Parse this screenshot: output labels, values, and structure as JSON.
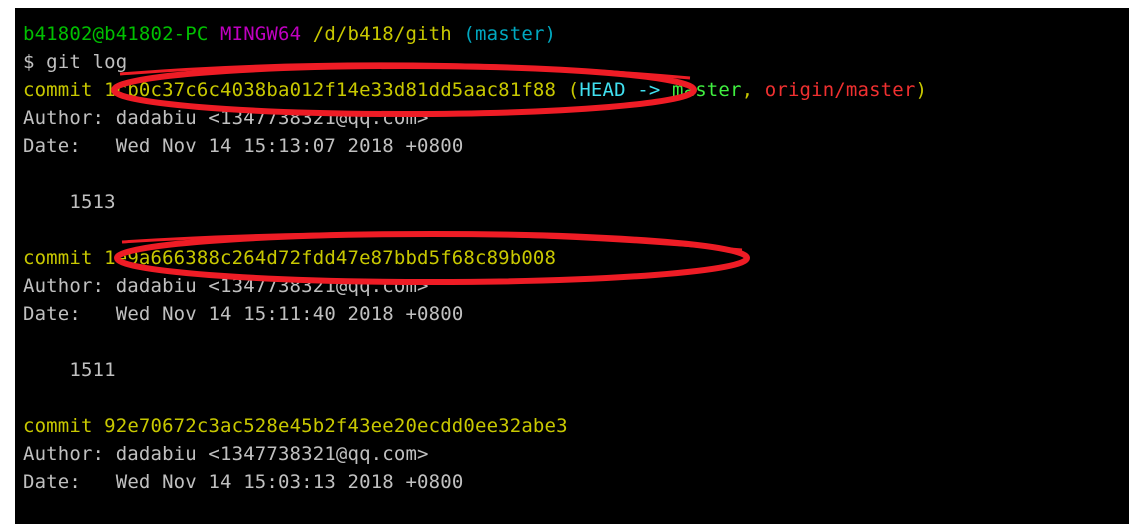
{
  "prompt": {
    "user_host": "b41802@b41802-PC",
    "system": "MINGW64",
    "path": "/d/b418/gith",
    "branch": "(master)",
    "command": "$ git log"
  },
  "commits": [
    {
      "keyword": "commit",
      "hash": "1cb0c37c6c4038ba012f14e33d81dd5aac81f88",
      "refs": {
        "open": "(",
        "head": "HEAD -> ",
        "branch": "master",
        "sep": ", ",
        "remote": "origin/master",
        "close": ")"
      },
      "author_label": "Author:",
      "author": "dadabiu <1347738321@qq.com>",
      "date_label": "Date:",
      "date": "Wed Nov 14 15:13:07 2018 +0800",
      "message": "1513"
    },
    {
      "keyword": "commit",
      "hash": "1e9a666388c264d72fdd47e87bbd5f68c89b008",
      "author_label": "Author:",
      "author": "dadabiu <1347738321@qq.com>",
      "date_label": "Date:",
      "date": "Wed Nov 14 15:11:40 2018 +0800",
      "message": "1511"
    },
    {
      "keyword": "commit",
      "hash": "92e70672c3ac528e45b2f43ee20ecdd0ee32abe3",
      "author_label": "Author:",
      "author": "dadabiu <1347738321@qq.com>",
      "date_label": "Date:",
      "date": "Wed Nov 14 15:03:13 2018 +0800"
    }
  ],
  "colors": {
    "background": "#000000",
    "prompt_user": "#00c000",
    "prompt_system": "#c000c0",
    "prompt_path": "#c8c800",
    "prompt_branch": "#00a8c0",
    "commit": "#c8c800",
    "head": "#40e0f0",
    "local_branch": "#40f040",
    "remote_branch": "#f03030",
    "text": "#c0c0c0",
    "annotation": "#ee1c25"
  }
}
